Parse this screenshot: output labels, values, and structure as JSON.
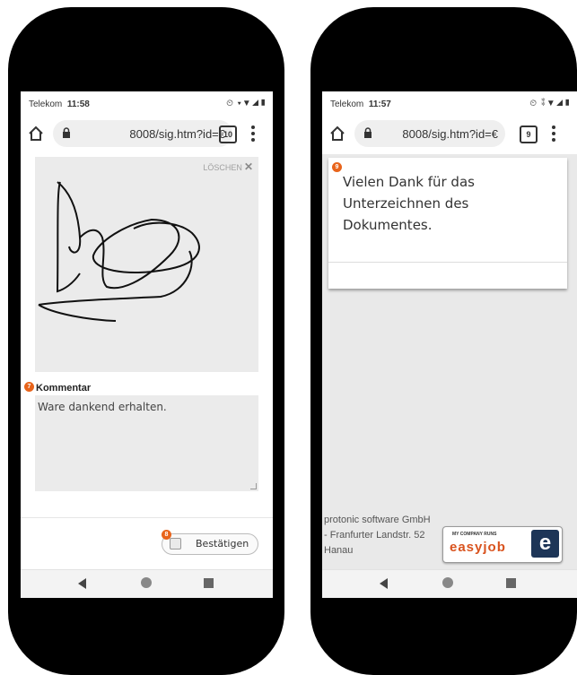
{
  "left_screen": {
    "status": {
      "carrier": "Telekom",
      "time": "11:58",
      "icons": "⏲ ▾▼◢▮"
    },
    "browser": {
      "url": "8008/sig.htm?id=€",
      "tab_count": "10"
    },
    "signature": {
      "clear_label": "LÖSCHEN",
      "clear_icon": "close-icon"
    },
    "comment": {
      "badge": "7",
      "label": "Kommentar",
      "value": "Ware dankend erhalten."
    },
    "confirm": {
      "badge": "8",
      "label": "Bestätigen"
    }
  },
  "right_screen": {
    "status": {
      "carrier": "Telekom",
      "time": "11:57",
      "icons": "⏲ ⁑▼◢▮"
    },
    "browser": {
      "url": "8008/sig.htm?id=€",
      "tab_count": "9"
    },
    "message": {
      "badge": "9",
      "text": "Vielen Dank für das Unterzeichnen des Dokumentes."
    },
    "footer": {
      "company_line1": "protonic software GmbH",
      "company_line2": "- Franfurter Landstr. 52",
      "company_line3": "Hanau",
      "logo_tagline": "MY COMPANY RUNS",
      "logo_word": "easyjob",
      "logo_letter": "e"
    }
  },
  "colors": {
    "badge": "#e8641b",
    "logo_orange": "#d9531e",
    "logo_blue": "#1d3557"
  }
}
